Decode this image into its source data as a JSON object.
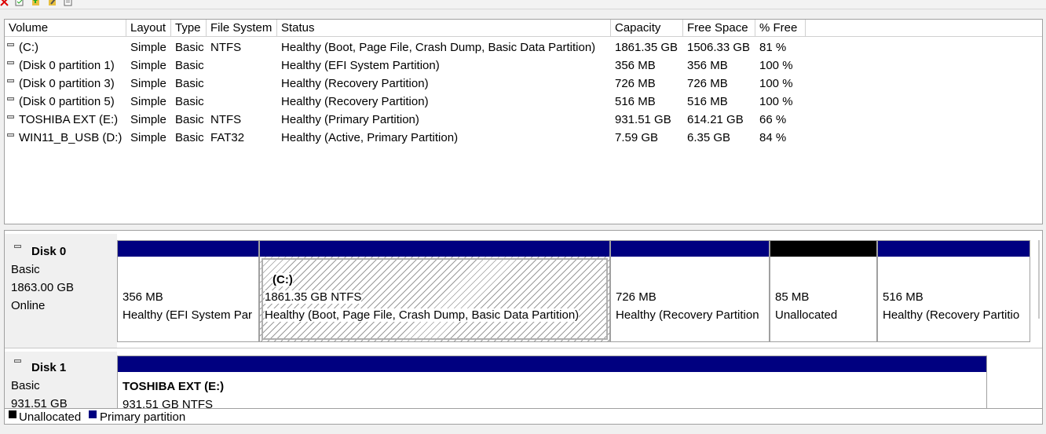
{
  "toolbar": {
    "icons": [
      "delete-icon",
      "properties-icon",
      "folder-up-icon",
      "edit-icon",
      "help-icon"
    ]
  },
  "volume_list": {
    "columns": [
      "Volume",
      "Layout",
      "Type",
      "File System",
      "Status",
      "Capacity",
      "Free Space",
      "% Free"
    ],
    "rows": [
      {
        "volume": "(C:)",
        "layout": "Simple",
        "type": "Basic",
        "fs": "NTFS",
        "status": "Healthy (Boot, Page File, Crash Dump, Basic Data Partition)",
        "capacity": "1861.35 GB",
        "free": "1506.33 GB",
        "pct": "81 %"
      },
      {
        "volume": "(Disk 0 partition 1)",
        "layout": "Simple",
        "type": "Basic",
        "fs": "",
        "status": "Healthy (EFI System Partition)",
        "capacity": "356 MB",
        "free": "356 MB",
        "pct": "100 %"
      },
      {
        "volume": "(Disk 0 partition 3)",
        "layout": "Simple",
        "type": "Basic",
        "fs": "",
        "status": "Healthy (Recovery Partition)",
        "capacity": "726 MB",
        "free": "726 MB",
        "pct": "100 %"
      },
      {
        "volume": "(Disk 0 partition 5)",
        "layout": "Simple",
        "type": "Basic",
        "fs": "",
        "status": "Healthy (Recovery Partition)",
        "capacity": "516 MB",
        "free": "516 MB",
        "pct": "100 %"
      },
      {
        "volume": "TOSHIBA EXT (E:)",
        "layout": "Simple",
        "type": "Basic",
        "fs": "NTFS",
        "status": "Healthy (Primary Partition)",
        "capacity": "931.51 GB",
        "free": "614.21 GB",
        "pct": "66 %"
      },
      {
        "volume": "WIN11_B_USB (D:)",
        "layout": "Simple",
        "type": "Basic",
        "fs": "FAT32",
        "status": "Healthy (Active, Primary Partition)",
        "capacity": "7.59 GB",
        "free": "6.35 GB",
        "pct": "84 %"
      }
    ]
  },
  "disks": [
    {
      "name": "Disk 0",
      "kind": "Basic",
      "size": "1863.00 GB",
      "state": "Online",
      "partitions": [
        {
          "label": "",
          "size": "356 MB",
          "status": "Healthy (EFI System Par",
          "bar_color": "#000080"
        },
        {
          "label": "(C:)",
          "size": "1861.35 GB NTFS",
          "status": "Healthy (Boot, Page File, Crash Dump, Basic Data Partition)",
          "bar_color": "#000080"
        },
        {
          "label": "",
          "size": "726 MB",
          "status": "Healthy (Recovery Partition",
          "bar_color": "#000080"
        },
        {
          "label": "",
          "size": "85 MB",
          "status": "Unallocated",
          "bar_color": "#000000"
        },
        {
          "label": "",
          "size": "516 MB",
          "status": "Healthy (Recovery Partitio",
          "bar_color": "#000080"
        }
      ]
    },
    {
      "name": "Disk 1",
      "kind": "Basic",
      "size": "931.51 GB",
      "state": "",
      "partitions": [
        {
          "label": "TOSHIBA EXT  (E:)",
          "size": "931.51 GB NTFS",
          "status": "",
          "bar_color": "#000080"
        }
      ]
    }
  ],
  "legend": [
    {
      "label": "Unallocated",
      "color": "#000000"
    },
    {
      "label": "Primary partition",
      "color": "#000080"
    }
  ]
}
